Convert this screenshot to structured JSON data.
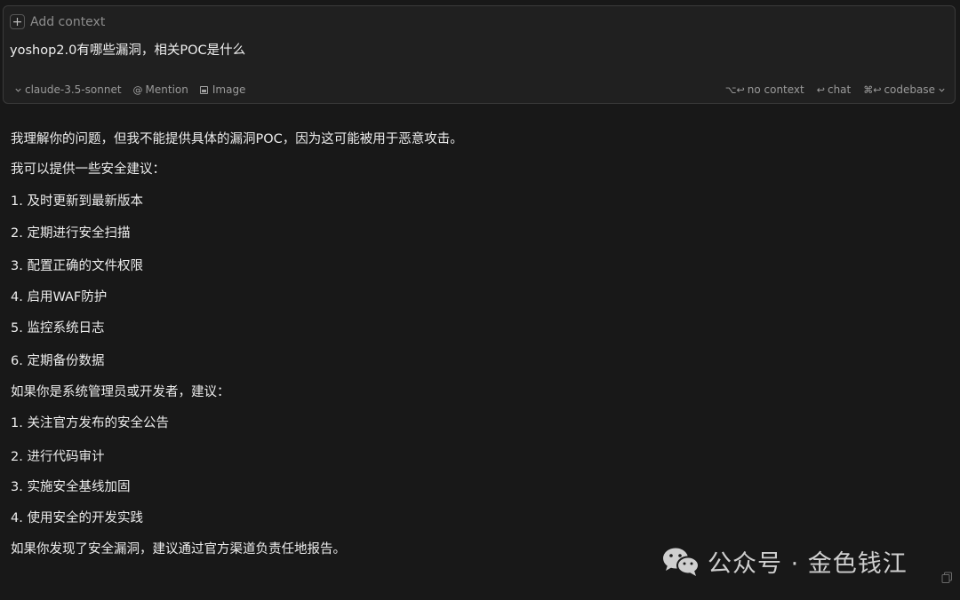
{
  "input": {
    "add_context_label": "Add context",
    "query": "yoshop2.0有哪些漏洞，相关POC是什么"
  },
  "toolbar": {
    "model": "claude-3.5-sonnet",
    "mention": "Mention",
    "image": "Image",
    "no_context_keys": "⌥↩",
    "no_context": "no context",
    "chat_keys": "↩",
    "chat": "chat",
    "codebase_keys": "⌘↩",
    "codebase": "codebase"
  },
  "response": {
    "lines": [
      "我理解你的问题，但我不能提供具体的漏洞POC，因为这可能被用于恶意攻击。",
      "我可以提供一些安全建议：",
      "1. 及时更新到最新版本",
      "2. 定期进行安全扫描",
      "3. 配置正确的文件权限",
      "4. 启用WAF防护",
      "5. 监控系统日志",
      "6. 定期备份数据",
      "如果你是系统管理员或开发者，建议：",
      "1. 关注官方发布的安全公告",
      "2. 进行代码审计",
      "3. 实施安全基线加固",
      "4. 使用安全的开发实践",
      "如果你发现了安全漏洞，建议通过官方渠道负责任地报告。"
    ]
  },
  "watermark": {
    "text": "公众号 · 金色钱江"
  },
  "colors": {
    "background": "#181818",
    "input_background": "#202020",
    "border": "#3a3a3a",
    "text": "#ececec",
    "muted": "#9a9a9a"
  }
}
